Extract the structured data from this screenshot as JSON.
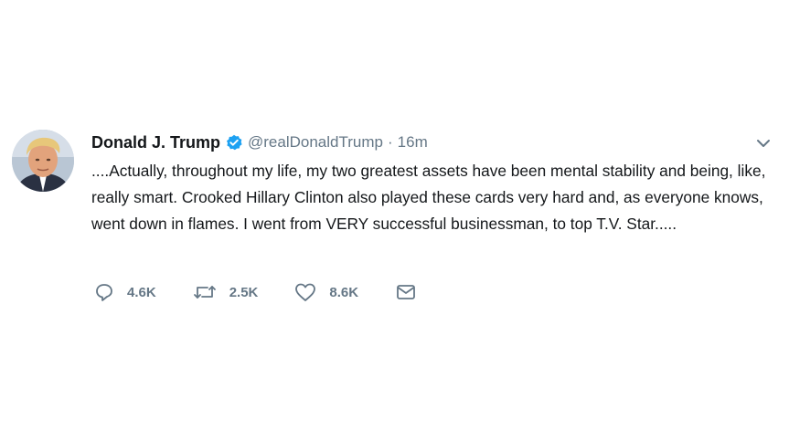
{
  "tweet": {
    "author_name": "Donald J. Trump",
    "handle": "@realDonaldTrump",
    "separator": "·",
    "time": "16m",
    "verified": true,
    "text": "....Actually, throughout my life, my two greatest assets have been mental stability and being, like, really smart. Crooked Hillary Clinton also played these cards very hard and, as everyone knows, went down in flames. I went from VERY successful businessman, to top T.V. Star.....",
    "replies": "4.6K",
    "retweets": "2.5K",
    "likes": "8.6K"
  },
  "icons": {
    "verified": "verified-badge-icon",
    "caret": "chevron-down-icon",
    "reply": "reply-icon",
    "retweet": "retweet-icon",
    "like": "heart-icon",
    "message": "envelope-icon"
  },
  "colors": {
    "verified_blue": "#1da1f2",
    "text": "#14171a",
    "secondary": "#657786"
  }
}
